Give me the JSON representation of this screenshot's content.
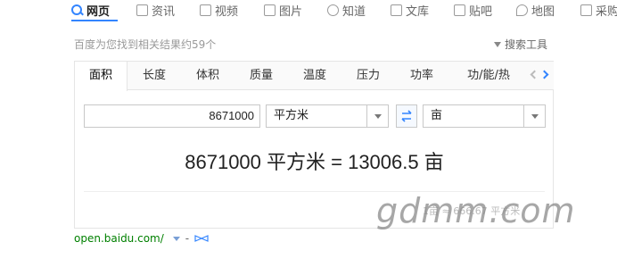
{
  "nav": {
    "items": [
      {
        "label": "网页",
        "icon": "search-icon"
      },
      {
        "label": "资讯",
        "icon": "news-icon"
      },
      {
        "label": "视频",
        "icon": "video-icon"
      },
      {
        "label": "图片",
        "icon": "image-icon"
      },
      {
        "label": "知道",
        "icon": "question-icon"
      },
      {
        "label": "文库",
        "icon": "document-icon"
      },
      {
        "label": "贴吧",
        "icon": "tieba-icon"
      },
      {
        "label": "地图",
        "icon": "map-pin-icon"
      },
      {
        "label": "采购",
        "icon": "shopping-bag-icon"
      }
    ]
  },
  "results": {
    "count_text": "百度为您找到相关结果约59个",
    "tools_label": "搜索工具"
  },
  "converter": {
    "tabs": [
      "面积",
      "长度",
      "体积",
      "质量",
      "温度",
      "压力",
      "功率",
      "功/能/热"
    ],
    "active_tab": "面积",
    "input_value": "8671000",
    "from_unit": "平方米",
    "to_unit": "亩",
    "result_text": "8671000 平方米 = 13006.5 亩",
    "fineprint": "1亩 ≈ 666.67 平方米"
  },
  "watermark": "gdmm.com",
  "source": {
    "url": "open.baidu.com/",
    "dash": "-"
  },
  "colors": {
    "accent": "#3385ff",
    "url_green": "#008000",
    "text": "#333333"
  }
}
